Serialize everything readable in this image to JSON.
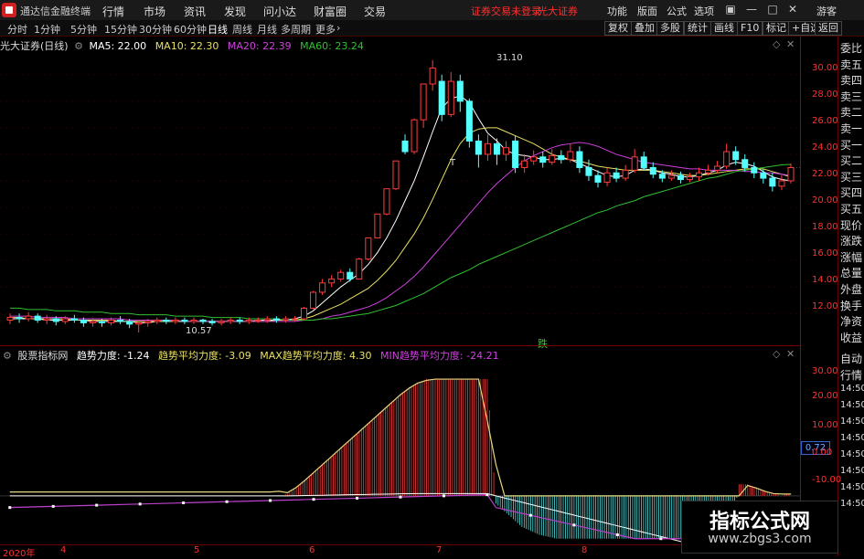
{
  "menubar": {
    "app_title": "通达信金融终端",
    "items": [
      "行情",
      "市场",
      "资讯",
      "发现",
      "问小达",
      "财富圈",
      "交易"
    ],
    "notice": "证券交易未登录",
    "broker": "光大证券",
    "right_items": [
      "功能",
      "版面",
      "公式",
      "选项"
    ],
    "guest": "游客"
  },
  "tabs": {
    "items": [
      "分时",
      "1分钟",
      "5分钟",
      "15分钟",
      "30分钟",
      "60分钟",
      "日线",
      "周线",
      "月线",
      "多周期",
      "更多"
    ],
    "active": "日线",
    "right_buttons": [
      "复权",
      "叠加",
      "多股",
      "统计",
      "画线",
      "F10",
      "标记",
      "+自选",
      "返回"
    ]
  },
  "main": {
    "stock": "光大证券(日线)",
    "ma": [
      {
        "label": "MA5: 22.00",
        "color": "#ffffff"
      },
      {
        "label": "MA10: 22.30",
        "color": "#e8e060"
      },
      {
        "label": "MA20: 22.39",
        "color": "#d040e0"
      },
      {
        "label": "MA60: 23.24",
        "color": "#30c030"
      }
    ],
    "yticks": [
      "30.00",
      "28.00",
      "26.00",
      "24.00",
      "22.00",
      "20.00",
      "18.00",
      "16.00",
      "14.00",
      "12.00"
    ],
    "high_label": "31.10",
    "low_label": "10.57",
    "t_label": "T",
    "die_label": "跌"
  },
  "indicator": {
    "name": "股票指标网",
    "params": [
      {
        "label": "趋势力度: -1.24",
        "color": "#ffffff"
      },
      {
        "label": "趋势平均力度: -3.09",
        "color": "#e8e060"
      },
      {
        "label": "MAX趋势平均力度: 4.30",
        "color": "#e8e060"
      },
      {
        "label": "MIN趋势平均力度: -24.21",
        "color": "#d040e0"
      }
    ],
    "yticks": [
      "30.00",
      "20.00",
      "10.00",
      "0.00",
      "-10.00"
    ],
    "current_value": "0.72"
  },
  "sidebar": {
    "top_items": [
      "委比",
      "卖五",
      "卖四",
      "卖三",
      "卖二",
      "卖一",
      "买一",
      "买二",
      "买三",
      "买四",
      "买五",
      "现价",
      "涨跌",
      "涨幅",
      "总量",
      "外盘",
      "换手",
      "净资",
      "收益"
    ],
    "bottom_items": [
      "自动",
      "行情",
      "14:50",
      "14:50",
      "14:50",
      "14:50",
      "14:50",
      "14:50",
      "14:50",
      "14:50"
    ]
  },
  "xaxis": {
    "labels": [
      "2020年",
      "4",
      "5",
      "6",
      "7",
      "8"
    ]
  },
  "watermark": {
    "title": "指标公式网",
    "url": "www.zbgs3.com"
  },
  "chart_data": {
    "type": "candlestick",
    "price_range": [
      10.5,
      31.5
    ],
    "candles": [
      {
        "o": 11.5,
        "c": 11.7,
        "h": 12.0,
        "l": 11.2
      },
      {
        "o": 11.7,
        "c": 11.6,
        "h": 12.0,
        "l": 11.3
      },
      {
        "o": 11.6,
        "c": 11.8,
        "h": 12.1,
        "l": 11.4
      },
      {
        "o": 11.8,
        "c": 11.5,
        "h": 12.0,
        "l": 11.3
      },
      {
        "o": 11.5,
        "c": 11.6,
        "h": 11.9,
        "l": 11.2
      },
      {
        "o": 11.6,
        "c": 11.4,
        "h": 11.8,
        "l": 11.1
      },
      {
        "o": 11.4,
        "c": 11.6,
        "h": 11.8,
        "l": 11.2
      },
      {
        "o": 11.6,
        "c": 11.5,
        "h": 11.9,
        "l": 11.3
      },
      {
        "o": 11.5,
        "c": 11.3,
        "h": 11.7,
        "l": 11.0
      },
      {
        "o": 11.3,
        "c": 11.4,
        "h": 11.6,
        "l": 11.0
      },
      {
        "o": 11.4,
        "c": 11.3,
        "h": 11.6,
        "l": 11.0
      },
      {
        "o": 11.3,
        "c": 11.5,
        "h": 11.7,
        "l": 11.1
      },
      {
        "o": 11.5,
        "c": 11.4,
        "h": 11.8,
        "l": 11.2
      },
      {
        "o": 11.4,
        "c": 11.2,
        "h": 11.6,
        "l": 10.9
      },
      {
        "o": 11.2,
        "c": 11.3,
        "h": 11.5,
        "l": 10.57
      },
      {
        "o": 11.3,
        "c": 11.4,
        "h": 11.6,
        "l": 11.0
      },
      {
        "o": 11.4,
        "c": 11.5,
        "h": 11.7,
        "l": 11.2
      },
      {
        "o": 11.5,
        "c": 11.4,
        "h": 11.7,
        "l": 11.2
      },
      {
        "o": 11.4,
        "c": 11.5,
        "h": 11.7,
        "l": 11.2
      },
      {
        "o": 11.5,
        "c": 11.4,
        "h": 11.7,
        "l": 11.2
      },
      {
        "o": 11.4,
        "c": 11.5,
        "h": 11.7,
        "l": 11.2
      },
      {
        "o": 11.5,
        "c": 11.4,
        "h": 11.6,
        "l": 11.2
      },
      {
        "o": 11.4,
        "c": 11.3,
        "h": 11.6,
        "l": 11.1
      },
      {
        "o": 11.3,
        "c": 11.4,
        "h": 11.6,
        "l": 11.1
      },
      {
        "o": 11.4,
        "c": 11.5,
        "h": 11.7,
        "l": 11.2
      },
      {
        "o": 11.5,
        "c": 11.4,
        "h": 11.7,
        "l": 11.2
      },
      {
        "o": 11.4,
        "c": 11.5,
        "h": 11.7,
        "l": 11.2
      },
      {
        "o": 11.5,
        "c": 11.5,
        "h": 11.7,
        "l": 11.3
      },
      {
        "o": 11.5,
        "c": 11.6,
        "h": 11.8,
        "l": 11.3
      },
      {
        "o": 11.6,
        "c": 11.5,
        "h": 11.8,
        "l": 11.3
      },
      {
        "o": 11.5,
        "c": 11.6,
        "h": 11.8,
        "l": 11.3
      },
      {
        "o": 11.6,
        "c": 11.6,
        "h": 11.8,
        "l": 11.4
      },
      {
        "o": 11.6,
        "c": 12.4,
        "h": 12.5,
        "l": 11.5
      },
      {
        "o": 12.4,
        "c": 13.6,
        "h": 13.7,
        "l": 12.3
      },
      {
        "o": 13.6,
        "c": 14.3,
        "h": 14.6,
        "l": 13.4
      },
      {
        "o": 14.3,
        "c": 14.6,
        "h": 14.9,
        "l": 14.0
      },
      {
        "o": 14.6,
        "c": 15.1,
        "h": 15.3,
        "l": 14.4
      },
      {
        "o": 15.1,
        "c": 14.6,
        "h": 15.4,
        "l": 14.4
      },
      {
        "o": 14.6,
        "c": 16.1,
        "h": 16.2,
        "l": 14.6
      },
      {
        "o": 16.1,
        "c": 17.7,
        "h": 17.7,
        "l": 16.0
      },
      {
        "o": 17.7,
        "c": 19.5,
        "h": 19.5,
        "l": 17.7
      },
      {
        "o": 19.5,
        "c": 21.4,
        "h": 21.4,
        "l": 19.4
      },
      {
        "o": 21.4,
        "c": 23.5,
        "h": 23.5,
        "l": 21.3
      },
      {
        "o": 25.0,
        "c": 24.2,
        "h": 25.5,
        "l": 24.0
      },
      {
        "o": 24.2,
        "c": 26.6,
        "h": 26.7,
        "l": 24.0
      },
      {
        "o": 26.6,
        "c": 29.3,
        "h": 29.3,
        "l": 26.0
      },
      {
        "o": 29.3,
        "c": 30.5,
        "h": 31.1,
        "l": 28.8
      },
      {
        "o": 29.5,
        "c": 27.0,
        "h": 30.0,
        "l": 26.5
      },
      {
        "o": 27.0,
        "c": 29.5,
        "h": 30.2,
        "l": 26.8
      },
      {
        "o": 29.5,
        "c": 28.0,
        "h": 30.0,
        "l": 27.2
      },
      {
        "o": 28.0,
        "c": 25.0,
        "h": 28.2,
        "l": 24.5
      },
      {
        "o": 25.0,
        "c": 24.0,
        "h": 25.5,
        "l": 23.0
      },
      {
        "o": 24.0,
        "c": 24.8,
        "h": 25.5,
        "l": 23.5
      },
      {
        "o": 24.8,
        "c": 24.0,
        "h": 25.2,
        "l": 23.2
      },
      {
        "o": 24.0,
        "c": 24.5,
        "h": 25.0,
        "l": 23.5
      },
      {
        "o": 25.0,
        "c": 23.0,
        "h": 25.4,
        "l": 22.6
      },
      {
        "o": 23.0,
        "c": 23.5,
        "h": 24.0,
        "l": 22.6
      },
      {
        "o": 23.5,
        "c": 23.8,
        "h": 24.3,
        "l": 23.2
      },
      {
        "o": 23.8,
        "c": 23.4,
        "h": 24.2,
        "l": 23.0
      },
      {
        "o": 23.4,
        "c": 23.9,
        "h": 24.4,
        "l": 23.2
      },
      {
        "o": 23.9,
        "c": 23.6,
        "h": 24.3,
        "l": 23.3
      },
      {
        "o": 23.6,
        "c": 24.2,
        "h": 24.8,
        "l": 23.4
      },
      {
        "o": 24.2,
        "c": 23.0,
        "h": 24.6,
        "l": 22.6
      },
      {
        "o": 23.0,
        "c": 22.4,
        "h": 23.6,
        "l": 22.0
      },
      {
        "o": 22.4,
        "c": 21.9,
        "h": 22.8,
        "l": 21.5
      },
      {
        "o": 21.9,
        "c": 22.6,
        "h": 23.0,
        "l": 21.6
      },
      {
        "o": 22.6,
        "c": 22.2,
        "h": 23.0,
        "l": 21.9
      },
      {
        "o": 22.2,
        "c": 22.8,
        "h": 23.2,
        "l": 22.0
      },
      {
        "o": 22.8,
        "c": 23.8,
        "h": 24.4,
        "l": 22.6
      },
      {
        "o": 23.8,
        "c": 23.0,
        "h": 24.2,
        "l": 22.8
      },
      {
        "o": 23.0,
        "c": 22.5,
        "h": 23.4,
        "l": 22.2
      },
      {
        "o": 22.5,
        "c": 22.2,
        "h": 22.8,
        "l": 21.9
      },
      {
        "o": 22.2,
        "c": 22.4,
        "h": 22.8,
        "l": 22.0
      },
      {
        "o": 22.4,
        "c": 22.1,
        "h": 22.7,
        "l": 21.8
      },
      {
        "o": 22.1,
        "c": 22.3,
        "h": 22.6,
        "l": 21.9
      },
      {
        "o": 22.3,
        "c": 22.6,
        "h": 23.0,
        "l": 22.0
      },
      {
        "o": 22.6,
        "c": 22.8,
        "h": 23.2,
        "l": 22.4
      },
      {
        "o": 22.8,
        "c": 23.1,
        "h": 23.5,
        "l": 22.6
      },
      {
        "o": 23.1,
        "c": 24.2,
        "h": 24.8,
        "l": 22.9
      },
      {
        "o": 24.2,
        "c": 23.6,
        "h": 24.6,
        "l": 23.2
      },
      {
        "o": 23.6,
        "c": 23.0,
        "h": 24.0,
        "l": 22.7
      },
      {
        "o": 23.0,
        "c": 22.6,
        "h": 23.4,
        "l": 22.2
      },
      {
        "o": 22.6,
        "c": 22.2,
        "h": 22.9,
        "l": 21.8
      },
      {
        "o": 22.2,
        "c": 21.6,
        "h": 22.6,
        "l": 21.2
      },
      {
        "o": 21.6,
        "c": 22.0,
        "h": 22.4,
        "l": 21.3
      },
      {
        "o": 22.0,
        "c": 23.0,
        "h": 23.3,
        "l": 21.8
      }
    ],
    "ma_lines": {
      "MA5": [
        11.6,
        11.6,
        11.6,
        11.6,
        11.5,
        11.5,
        11.5,
        11.5,
        11.5,
        11.4,
        11.4,
        11.4,
        11.4,
        11.4,
        11.3,
        11.3,
        11.4,
        11.4,
        11.4,
        11.4,
        11.4,
        11.4,
        11.4,
        11.4,
        11.4,
        11.4,
        11.4,
        11.5,
        11.5,
        11.5,
        11.5,
        11.6,
        11.8,
        12.2,
        12.8,
        13.4,
        14.0,
        14.5,
        15.0,
        15.7,
        16.6,
        17.7,
        19.0,
        20.5,
        22.0,
        23.8,
        25.7,
        27.5,
        28.2,
        28.4,
        27.9,
        26.7,
        25.6,
        25.0,
        24.3,
        24.0,
        23.9,
        23.8,
        23.6,
        23.6,
        23.7,
        23.6,
        23.3,
        23.0,
        22.7,
        22.4,
        22.3,
        22.4,
        22.8,
        22.9,
        22.8,
        22.6,
        22.5,
        22.3,
        22.3,
        22.4,
        22.6,
        22.8,
        23.2,
        23.4,
        23.3,
        23.1,
        22.7,
        22.3,
        22.1,
        22.0
      ],
      "MA10": [
        11.7,
        11.7,
        11.6,
        11.6,
        11.6,
        11.6,
        11.6,
        11.5,
        11.5,
        11.5,
        11.5,
        11.5,
        11.4,
        11.4,
        11.4,
        11.4,
        11.4,
        11.4,
        11.4,
        11.4,
        11.4,
        11.4,
        11.4,
        11.4,
        11.4,
        11.4,
        11.4,
        11.4,
        11.4,
        11.5,
        11.5,
        11.5,
        11.6,
        11.8,
        12.1,
        12.4,
        12.7,
        13.1,
        13.5,
        13.9,
        14.5,
        15.2,
        16.0,
        17.0,
        18.0,
        19.2,
        20.6,
        22.1,
        23.6,
        24.8,
        25.6,
        25.9,
        26.0,
        26.0,
        25.7,
        25.4,
        25.1,
        24.8,
        24.4,
        24.0,
        23.8,
        23.6,
        23.5,
        23.3,
        23.1,
        23.0,
        22.9,
        22.8,
        22.8,
        22.8,
        22.8,
        22.7,
        22.6,
        22.5,
        22.4,
        22.4,
        22.5,
        22.6,
        22.7,
        22.8,
        22.9,
        22.9,
        22.9,
        22.7,
        22.5,
        22.3
      ],
      "MA20": [
        11.8,
        11.8,
        11.8,
        11.7,
        11.7,
        11.7,
        11.7,
        11.6,
        11.6,
        11.6,
        11.6,
        11.6,
        11.6,
        11.5,
        11.5,
        11.5,
        11.5,
        11.5,
        11.5,
        11.4,
        11.4,
        11.4,
        11.4,
        11.4,
        11.4,
        11.4,
        11.4,
        11.4,
        11.4,
        11.4,
        11.4,
        11.4,
        11.5,
        11.5,
        11.6,
        11.8,
        11.9,
        12.1,
        12.3,
        12.5,
        12.8,
        13.2,
        13.7,
        14.2,
        14.8,
        15.5,
        16.3,
        17.1,
        17.9,
        18.7,
        19.5,
        20.3,
        21.1,
        21.8,
        22.4,
        23.0,
        23.5,
        23.9,
        24.2,
        24.5,
        24.7,
        24.8,
        24.9,
        24.8,
        24.6,
        24.3,
        24.0,
        23.8,
        23.6,
        23.4,
        23.3,
        23.2,
        23.1,
        23.0,
        22.9,
        22.9,
        22.8,
        22.8,
        22.8,
        22.8,
        22.7,
        22.7,
        22.6,
        22.6,
        22.5,
        22.4
      ],
      "MA60": [
        12.4,
        12.4,
        12.3,
        12.3,
        12.3,
        12.2,
        12.2,
        12.2,
        12.1,
        12.1,
        12.1,
        12.0,
        12.0,
        12.0,
        11.9,
        11.9,
        11.9,
        11.9,
        11.8,
        11.8,
        11.8,
        11.8,
        11.7,
        11.7,
        11.7,
        11.7,
        11.6,
        11.6,
        11.6,
        11.6,
        11.5,
        11.5,
        11.5,
        11.5,
        11.6,
        11.6,
        11.7,
        11.8,
        11.9,
        12.0,
        12.2,
        12.4,
        12.6,
        12.9,
        13.2,
        13.5,
        13.9,
        14.3,
        14.7,
        15.0,
        15.3,
        15.7,
        16.0,
        16.3,
        16.6,
        16.9,
        17.2,
        17.5,
        17.8,
        18.1,
        18.4,
        18.7,
        19.0,
        19.3,
        19.6,
        19.8,
        20.1,
        20.3,
        20.5,
        20.8,
        21.0,
        21.2,
        21.4,
        21.6,
        21.8,
        22.0,
        22.2,
        22.3,
        22.5,
        22.7,
        22.8,
        22.9,
        23.0,
        23.1,
        23.2,
        23.24
      ]
    },
    "indicator_range": [
      -12,
      34
    ],
    "indicator_series": {
      "trend_strength": [
        0,
        0,
        0,
        0,
        0,
        0,
        0,
        0,
        0,
        0,
        0,
        0,
        0,
        0,
        0,
        0,
        0,
        0,
        0,
        0,
        0,
        0,
        0,
        0,
        0,
        0,
        0,
        0,
        0,
        0,
        0,
        0,
        0.5,
        2,
        4,
        6,
        8,
        10,
        12,
        14,
        16,
        18,
        20,
        22,
        24,
        26,
        28,
        29,
        30,
        30,
        30,
        30,
        30,
        30,
        30,
        30,
        -2,
        -4,
        -6,
        -8,
        -9,
        -10,
        -10.5,
        -11,
        -11,
        -11,
        -11,
        -11,
        -11,
        -11,
        -11,
        -11,
        -11,
        -11,
        -11,
        -11,
        -11,
        -11,
        -11,
        -11,
        -11,
        -11,
        -11,
        -11,
        3,
        3,
        2,
        1,
        0.5,
        0.2,
        0.72
      ]
    }
  }
}
